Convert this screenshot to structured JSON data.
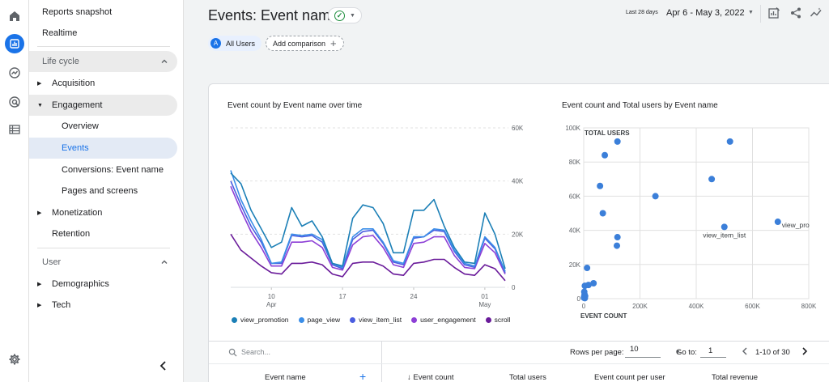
{
  "nav": {
    "reports_snapshot": "Reports snapshot",
    "realtime": "Realtime",
    "lifecycle_section": "Life cycle",
    "acquisition": "Acquisition",
    "engagement": "Engagement",
    "overview": "Overview",
    "events": "Events",
    "conversions": "Conversions: Event name",
    "pages_and_screens": "Pages and screens",
    "monetization": "Monetization",
    "retention": "Retention",
    "user_section": "User",
    "demographics": "Demographics",
    "tech": "Tech"
  },
  "header": {
    "title": "Events: Event name",
    "date_preset": "Last 28 days",
    "date_range": "Apr 6 - May 3, 2022"
  },
  "comparison": {
    "badge_letter": "A",
    "all_users": "All Users",
    "add_comparison": "Add comparison"
  },
  "line_chart": {
    "title": "Event count by Event name over time"
  },
  "scatter_chart": {
    "title": "Event count and Total users by Event name"
  },
  "chart_data": [
    {
      "type": "line",
      "title": "Event count by Event name over time",
      "x_ticks": [
        "10\nApr",
        "17",
        "24",
        "01\nMay"
      ],
      "y_ticks": [
        "0",
        "20K",
        "40K",
        "60K"
      ],
      "ylim": [
        0,
        60000
      ],
      "x": [
        "Apr 6",
        "Apr 7",
        "Apr 8",
        "Apr 9",
        "Apr 10",
        "Apr 11",
        "Apr 12",
        "Apr 13",
        "Apr 14",
        "Apr 15",
        "Apr 16",
        "Apr 17",
        "Apr 18",
        "Apr 19",
        "Apr 20",
        "Apr 21",
        "Apr 22",
        "Apr 23",
        "Apr 24",
        "Apr 25",
        "Apr 26",
        "Apr 27",
        "Apr 28",
        "Apr 29",
        "Apr 30",
        "May 1",
        "May 2",
        "May 3"
      ],
      "legend_position": "bottom",
      "grid": true,
      "series": [
        {
          "name": "view_promotion",
          "color": "#1b7fb6",
          "values": [
            43000,
            39000,
            29000,
            22000,
            15000,
            17000,
            30000,
            23000,
            25000,
            19000,
            9000,
            8000,
            26000,
            31000,
            30000,
            24000,
            13000,
            13000,
            29000,
            29000,
            33000,
            23000,
            15000,
            9500,
            9000,
            28000,
            20000,
            7000
          ]
        },
        {
          "name": "page_view",
          "color": "#3b8ee8",
          "values": [
            44000,
            33000,
            25000,
            18000,
            9000,
            9500,
            20000,
            19500,
            20000,
            18000,
            9000,
            7500,
            19000,
            22000,
            22000,
            17000,
            10000,
            9000,
            19000,
            19000,
            22000,
            21500,
            14000,
            9000,
            8000,
            19000,
            15000,
            6000
          ]
        },
        {
          "name": "view_item_list",
          "color": "#4a5de0",
          "values": [
            40000,
            31000,
            23000,
            17000,
            9000,
            9000,
            19500,
            19000,
            19500,
            17000,
            8500,
            7000,
            18000,
            21000,
            21500,
            16500,
            9500,
            8500,
            18500,
            19000,
            21500,
            21000,
            13500,
            8500,
            7500,
            18500,
            14500,
            5500
          ]
        },
        {
          "name": "user_engagement",
          "color": "#8d3fd6",
          "values": [
            38000,
            29000,
            21000,
            15000,
            8000,
            8000,
            17000,
            17000,
            17500,
            15000,
            7500,
            6500,
            16000,
            19000,
            19500,
            15000,
            8500,
            7500,
            16500,
            17000,
            19000,
            19000,
            12000,
            7500,
            7000,
            16500,
            13000,
            5000
          ]
        },
        {
          "name": "scroll",
          "color": "#6a1b9a",
          "values": [
            20000,
            14000,
            11000,
            8000,
            5500,
            5000,
            9000,
            9000,
            9500,
            8500,
            5000,
            4000,
            9000,
            9500,
            9500,
            8000,
            5000,
            4500,
            9000,
            9500,
            10500,
            10500,
            7500,
            5000,
            4500,
            8500,
            7000,
            2500
          ]
        }
      ]
    },
    {
      "type": "scatter",
      "title": "Event count and Total users by Event name",
      "xlabel": "EVENT COUNT",
      "ylabel": "TOTAL USERS",
      "x_ticks": [
        "0",
        "200K",
        "400K",
        "600K",
        "800K"
      ],
      "y_ticks": [
        "0",
        "20K",
        "40K",
        "60K",
        "80K",
        "100K"
      ],
      "xlim": [
        0,
        800000
      ],
      "ylim": [
        0,
        100000
      ],
      "grid": true,
      "color": "#3b7fd9",
      "points": [
        {
          "x": 120000,
          "y": 92000
        },
        {
          "x": 75000,
          "y": 84000
        },
        {
          "x": 58000,
          "y": 66000
        },
        {
          "x": 68000,
          "y": 50000
        },
        {
          "x": 120000,
          "y": 36000
        },
        {
          "x": 118000,
          "y": 31000
        },
        {
          "x": 255000,
          "y": 60000
        },
        {
          "x": 455000,
          "y": 70000
        },
        {
          "x": 520000,
          "y": 92000
        },
        {
          "x": 500000,
          "y": 42000,
          "label": "view_item_list"
        },
        {
          "x": 690000,
          "y": 45000,
          "label": "view_pro"
        },
        {
          "x": 12000,
          "y": 18000
        },
        {
          "x": 35000,
          "y": 9000
        },
        {
          "x": 17000,
          "y": 8000
        },
        {
          "x": 4000,
          "y": 7500
        },
        {
          "x": 2000,
          "y": 4000
        },
        {
          "x": 3000,
          "y": 2500
        },
        {
          "x": 1500,
          "y": 1000
        },
        {
          "x": 5000,
          "y": 1500
        },
        {
          "x": 1000,
          "y": 500
        },
        {
          "x": 4000,
          "y": 300
        }
      ]
    }
  ],
  "table": {
    "search_placeholder": "Search...",
    "rows_per_page_label": "Rows per page:",
    "rows_per_page_value": "10",
    "goto_label": "Go to:",
    "goto_value": "1",
    "range_text": "1-10 of 30",
    "col_event_name": "Event name",
    "col_event_count": "↓ Event count",
    "col_total_users": "Total users",
    "col_event_count_per_user": "Event count per user",
    "col_total_revenue": "Total revenue"
  }
}
